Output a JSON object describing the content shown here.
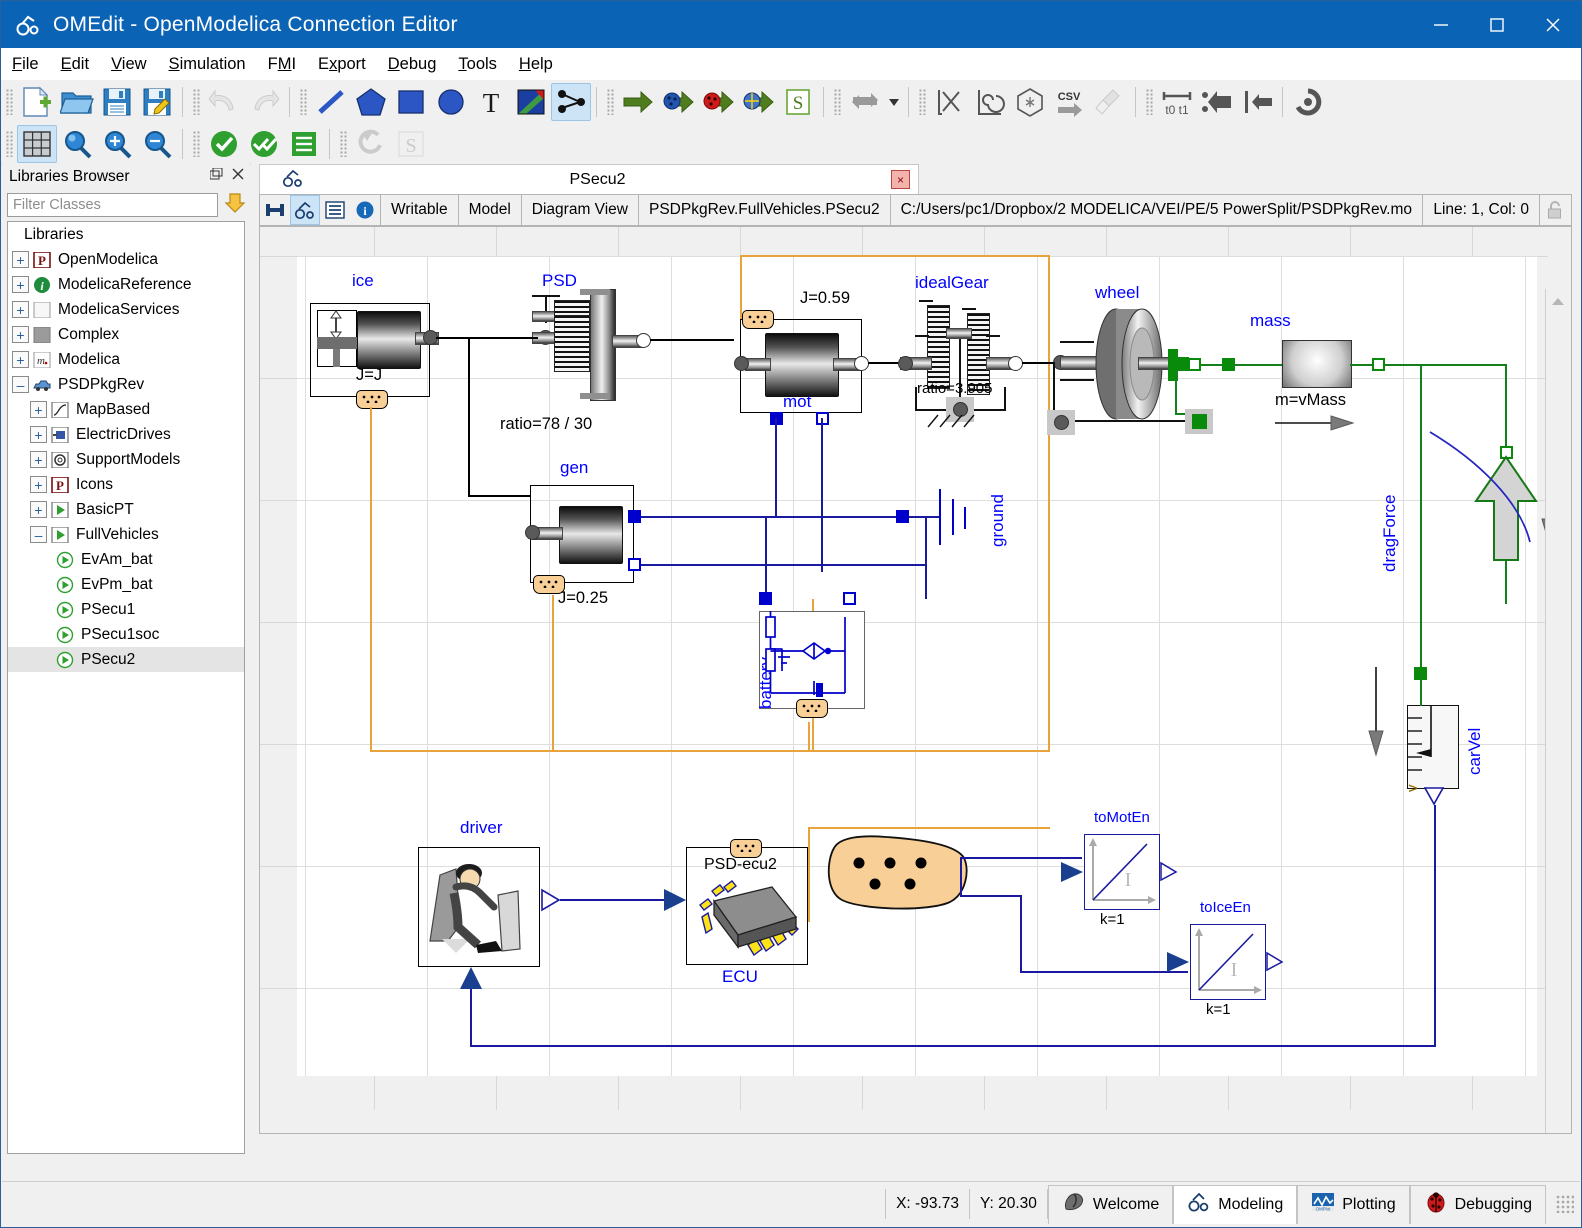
{
  "window": {
    "title": "OMEdit - OpenModelica Connection Editor",
    "minimize": "–",
    "maximize": "☐",
    "close": "✕"
  },
  "menu": [
    {
      "label": "File",
      "mnemonic": "F"
    },
    {
      "label": "Edit",
      "mnemonic": "E"
    },
    {
      "label": "View",
      "mnemonic": "V"
    },
    {
      "label": "Simulation",
      "mnemonic": "S"
    },
    {
      "label": "FMI",
      "mnemonic": "M"
    },
    {
      "label": "Export",
      "mnemonic": "x"
    },
    {
      "label": "Debug",
      "mnemonic": "D"
    },
    {
      "label": "Tools",
      "mnemonic": "T"
    },
    {
      "label": "Help",
      "mnemonic": "H"
    }
  ],
  "toolbar_row1": [
    {
      "name": "new-modelica-class-button",
      "icon": "new-file-icon"
    },
    {
      "name": "open-model-button",
      "icon": "open-folder-icon"
    },
    {
      "name": "save-button",
      "icon": "save-icon"
    },
    {
      "name": "save-as-button",
      "icon": "save-as-icon"
    },
    {
      "name": "undo-button",
      "icon": "undo-arrow-icon"
    },
    {
      "name": "redo-button",
      "icon": "redo-arrow-icon"
    },
    {
      "name": "line-tool-button",
      "icon": "line-icon"
    },
    {
      "name": "polygon-tool-button",
      "icon": "polygon-icon"
    },
    {
      "name": "rectangle-tool-button",
      "icon": "rectangle-icon"
    },
    {
      "name": "ellipse-tool-button",
      "icon": "ellipse-icon"
    },
    {
      "name": "text-tool-button",
      "icon": "text-t-icon"
    },
    {
      "name": "bitmap-tool-button",
      "icon": "bitmap-icon"
    },
    {
      "name": "connect-mode-button",
      "icon": "connect-nodes-icon"
    },
    {
      "name": "simulate-button",
      "icon": "green-arrow-icon"
    },
    {
      "name": "simulate-with-transformational-debugger-button",
      "icon": "blue-bug-arrow-icon"
    },
    {
      "name": "simulate-with-algorithmic-debugger-button",
      "icon": "red-bug-arrow-icon"
    },
    {
      "name": "simulate-with-animation-button",
      "icon": "animation-arrow-icon"
    },
    {
      "name": "simulation-setup-button",
      "icon": "letter-s-icon"
    },
    {
      "name": "re-simulate-button",
      "icon": "swap-arrows-icon"
    },
    {
      "name": "re-simulate-dropdown",
      "icon": "chevron-down-icon"
    },
    {
      "name": "plot-parametric-button",
      "icon": "plot-parametric-icon"
    },
    {
      "name": "array-parametric-plot-button",
      "icon": "spiral-plot-icon"
    },
    {
      "name": "diagram-window-button",
      "icon": "3d-cube-icon"
    },
    {
      "name": "export-csv-button",
      "icon": "csv-export-icon"
    },
    {
      "name": "clear-plot-button",
      "icon": "broom-icon"
    },
    {
      "name": "fit-to-diagram-button",
      "icon": "t0-t1-icon"
    },
    {
      "name": "previous-step-button",
      "icon": "step-backward-icon"
    },
    {
      "name": "next-step-button",
      "icon": "step-forward-icon"
    },
    {
      "name": "rotate-button",
      "icon": "rotate-icon"
    }
  ],
  "toolbar_row2": [
    {
      "name": "grid-lines-button",
      "icon": "grid-icon",
      "selected": true
    },
    {
      "name": "reset-zoom-button",
      "icon": "magnifier-icon"
    },
    {
      "name": "zoom-in-button",
      "icon": "magnifier-plus-icon"
    },
    {
      "name": "zoom-out-button",
      "icon": "magnifier-minus-icon"
    },
    {
      "name": "check-model-button",
      "icon": "green-check-icon"
    },
    {
      "name": "check-all-models-button",
      "icon": "green-double-check-icon"
    },
    {
      "name": "instantiate-model-button",
      "icon": "green-list-icon"
    },
    {
      "name": "export-figaro-button",
      "icon": "figaro-icon"
    },
    {
      "name": "export-to-omnotebook-button",
      "icon": "omnotebook-icon"
    }
  ],
  "libraries": {
    "panel_title": "Libraries Browser",
    "undock_icon": "undock-icon",
    "close_icon": "close-icon",
    "filter_placeholder": "Filter Classes",
    "filter_value": "",
    "dropdown_icon": "yellow-down-arrow-icon",
    "root_label": "Libraries",
    "items": [
      {
        "label": "OpenModelica",
        "indent": 0,
        "expander": "+",
        "icon": "package-p-icon"
      },
      {
        "label": "ModelicaReference",
        "indent": 0,
        "expander": "+",
        "icon": "info-icon"
      },
      {
        "label": "ModelicaServices",
        "indent": 0,
        "expander": "+",
        "icon": "white-square-icon"
      },
      {
        "label": "Complex",
        "indent": 0,
        "expander": "+",
        "icon": "gray-square-icon"
      },
      {
        "label": "Modelica",
        "indent": 0,
        "expander": "+",
        "icon": "modelica-m-icon"
      },
      {
        "label": "PSDPkgRev",
        "indent": 0,
        "expander": "–",
        "icon": "car-icon"
      },
      {
        "label": "MapBased",
        "indent": 1,
        "expander": "+",
        "icon": "curve-icon"
      },
      {
        "label": "ElectricDrives",
        "indent": 1,
        "expander": "+",
        "icon": "motor-icon"
      },
      {
        "label": "SupportModels",
        "indent": 1,
        "expander": "+",
        "icon": "gear-icon"
      },
      {
        "label": "Icons",
        "indent": 1,
        "expander": "+",
        "icon": "package-p-icon"
      },
      {
        "label": "BasicPT",
        "indent": 1,
        "expander": "+",
        "icon": "green-play-icon"
      },
      {
        "label": "FullVehicles",
        "indent": 1,
        "expander": "–",
        "icon": "green-play-icon"
      },
      {
        "label": "EvAm_bat",
        "indent": 2,
        "expander": "",
        "icon": "model-play-icon"
      },
      {
        "label": "EvPm_bat",
        "indent": 2,
        "expander": "",
        "icon": "model-play-icon"
      },
      {
        "label": "PSecu1",
        "indent": 2,
        "expander": "",
        "icon": "model-play-icon"
      },
      {
        "label": "PSecu1soc",
        "indent": 2,
        "expander": "",
        "icon": "model-play-icon"
      },
      {
        "label": "PSecu2",
        "indent": 2,
        "expander": "",
        "icon": "model-play-icon",
        "selected": true
      }
    ]
  },
  "mdi": {
    "tab_label": "PSecu2",
    "tab_icon": "model-icon",
    "close_label": "×"
  },
  "infobar": {
    "buttons": [
      {
        "name": "icon-view-button",
        "icon": "icon-view-icon",
        "selected": false
      },
      {
        "name": "diagram-view-button",
        "icon": "diagram-view-icon",
        "selected": true
      },
      {
        "name": "text-view-button",
        "icon": "text-view-icon",
        "selected": false
      },
      {
        "name": "documentation-view-button",
        "icon": "info-blue-icon",
        "selected": false
      }
    ],
    "writable": "Writable",
    "kind": "Model",
    "view": "Diagram View",
    "classname": "PSDPkgRev.FullVehicles.PSecu2",
    "filepath": "C:/Users/pc1/Dropbox/2 MODELICA/VEI/PE/5 PowerSplit/PSDPkgRev.mo",
    "position": "Line: 1, Col: 0",
    "lock_icon": "unlocked-padlock-icon"
  },
  "diagram": {
    "components": [
      {
        "id": "ice",
        "label": "ice",
        "param": "J=J"
      },
      {
        "id": "psd",
        "label": "PSD",
        "param": "ratio=78 / 30"
      },
      {
        "id": "mot",
        "label": "mot",
        "param": "J=0.59"
      },
      {
        "id": "idealGear",
        "label": "idealGear",
        "param": "ratio=3.905"
      },
      {
        "id": "wheel",
        "label": "wheel",
        "param": ""
      },
      {
        "id": "mass",
        "label": "mass",
        "param": "m=vMass"
      },
      {
        "id": "gen",
        "label": "gen",
        "param": "J=0.25"
      },
      {
        "id": "ground",
        "label": "ground",
        "param": ""
      },
      {
        "id": "battery",
        "label": "battery",
        "param": ""
      },
      {
        "id": "dragForce",
        "label": "dragForce",
        "param": ""
      },
      {
        "id": "carVel",
        "label": "carVel",
        "param": ""
      },
      {
        "id": "driver",
        "label": "driver",
        "param": ""
      },
      {
        "id": "ecu",
        "label": "ECU",
        "param": "PSD-ecu2"
      },
      {
        "id": "toMotEn",
        "label": "toMotEn",
        "param": "k=1"
      },
      {
        "id": "toIceEn",
        "label": "toIceEn",
        "param": "k=1"
      }
    ],
    "colors": {
      "component_label": "#0000ff",
      "mechanical_wire": "#000000",
      "electrical_wire": "#0000cc",
      "translational_wire": "#0a8a0a",
      "bus_wire": "#e8a33d"
    }
  },
  "statusbar": {
    "coord_x": "X: -93.73",
    "coord_y": "Y: 20.30",
    "tabs": [
      {
        "label": "Welcome",
        "icon": "welcome-icon",
        "active": false
      },
      {
        "label": "Modeling",
        "icon": "modeling-icon",
        "active": true
      },
      {
        "label": "Plotting",
        "icon": "plotting-icon",
        "active": false
      },
      {
        "label": "Debugging",
        "icon": "debugging-bug-icon",
        "active": false
      }
    ]
  }
}
